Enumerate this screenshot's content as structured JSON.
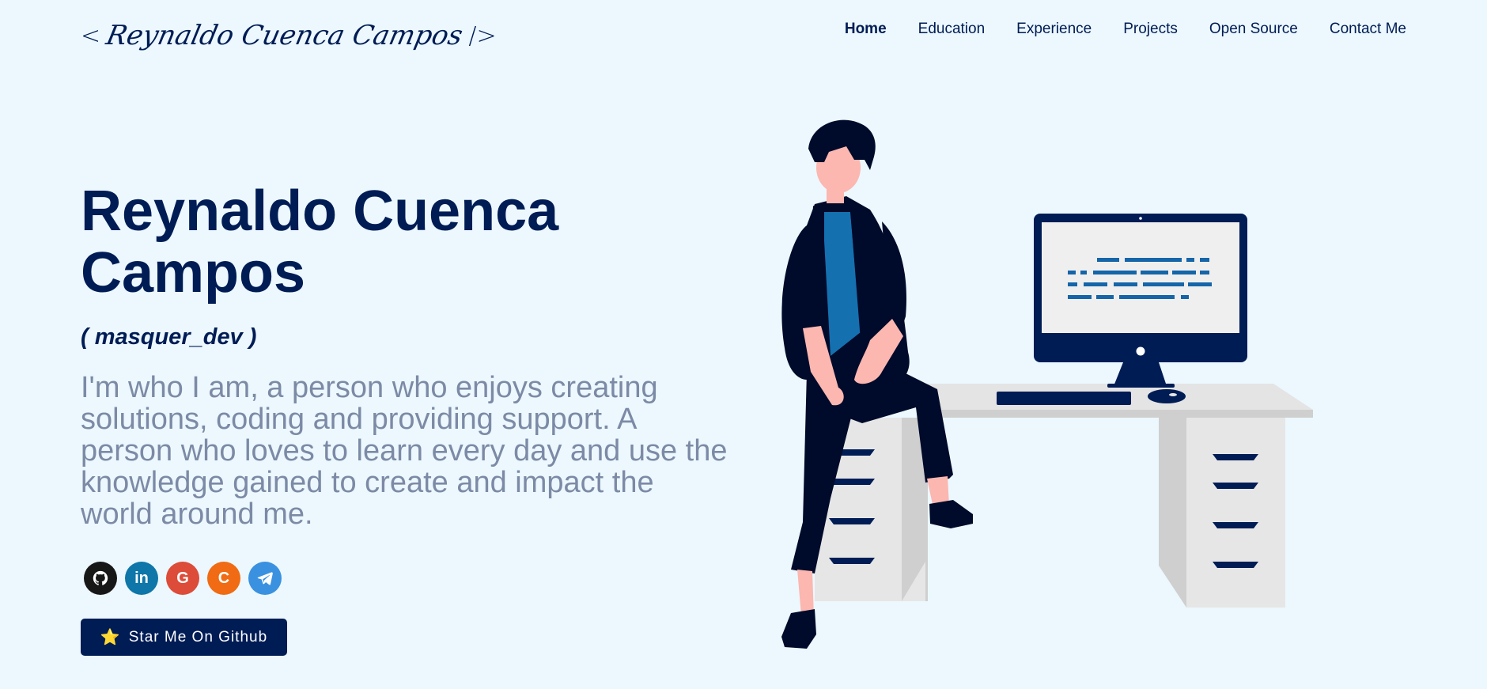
{
  "header": {
    "logo_open": "<",
    "logo_name": "Reynaldo Cuenca Campos",
    "logo_close": "/>",
    "nav": [
      "Home",
      "Education",
      "Experience",
      "Projects",
      "Open Source",
      "Contact Me"
    ],
    "active_nav": "Home"
  },
  "hero": {
    "title": "Reynaldo Cuenca Campos",
    "handle": "( masquer_dev )",
    "bio": "I'm who I am, a person who enjoys creating solutions, coding and providing support. A person who loves to learn every day and use the knowledge gained to create and impact the world around me.",
    "star_button": "Star Me On Github",
    "star_icon": "⭐"
  },
  "socials": [
    {
      "name": "github-icon",
      "color": "#181717"
    },
    {
      "name": "linkedin-icon",
      "color": "#0e76a8",
      "glyph": "in"
    },
    {
      "name": "google-icon",
      "color": "#dd4b39",
      "glyph": "G"
    },
    {
      "name": "codesandbox-icon",
      "color": "#f06b13",
      "glyph": "C"
    },
    {
      "name": "telegram-icon",
      "color": "#3a91e0"
    }
  ],
  "colors": {
    "background": "#ecf8fd",
    "primary": "#001c55",
    "muted_text": "#7c8aa6"
  }
}
